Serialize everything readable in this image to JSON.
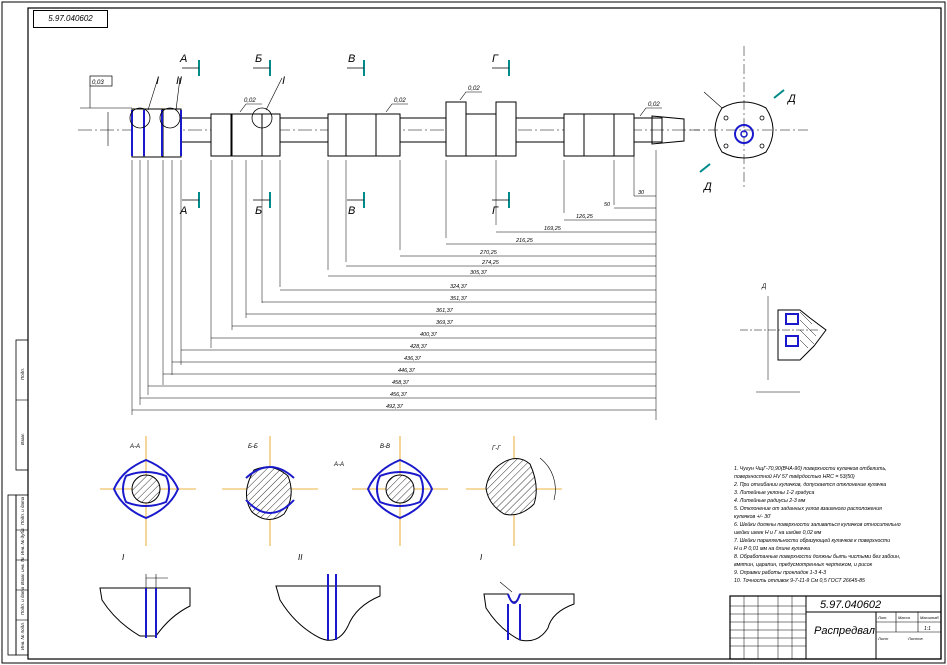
{
  "doc_code_top": "5.97.040602",
  "doc_code": "5.97.040602",
  "title": "Распредвал",
  "section_letters": [
    "А",
    "Б",
    "В",
    "Г"
  ],
  "detail_letters": [
    "I",
    "II"
  ],
  "view_letter": "Д",
  "tolerances": {
    "t1": "0,03",
    "t2": "0,02",
    "t3": "0,02",
    "t4": "0,02",
    "t5": "0,02"
  },
  "dims": [
    "30",
    "50",
    "126,25",
    "169,25",
    "216,25",
    "270,25",
    "274,25",
    "305,37",
    "324,37",
    "351,37",
    "361,37",
    "369,37",
    "400,37",
    "428,37",
    "436,37",
    "446,37",
    "458,37",
    "456,37",
    "492,37"
  ],
  "cam_labels": [
    "A-A",
    "Б-Б",
    "В-В",
    "Г-Г"
  ],
  "notes": [
    "1. Чугун ЧщГ-70,90(ВЧА-90) поверхности кулачков отбелить,",
    "   поверхностной HV 57 твёрдостью HRC = 53(50)",
    "2. При отгибании кулачков, допускается отклонение кулачка",
    "3. Литейные уклоны 1-2 градуса",
    "4. Литейные радиусы 2-3 мм",
    "5. Отклонение от заданных углов взаимного расположения",
    "   кулачков +/- 30'",
    "6. Шейки должны поверхности заливаться кулачков относительно",
    "   шейки шеек  Н и Г на шейке 0,02 мм",
    "7. Шейки параллельности образующей кулачков к поверхности",
    "   Н и Р 0,01 мм на длине кулачка",
    "8. Обработанные поверхности должны быть чистыми без забоин,",
    "   вмятин, царапин, предусмотренных чертежом, и рисок",
    "9. Оправки работы прокладок 1-3 4-3",
    "10. Точность отливок 9-7-11-9 См 0,5 ГОСТ 26645-85"
  ],
  "side_labels": [
    "Подп.",
    "Взам.",
    "Подп. и дата",
    "Инв. № дубл.",
    "Взам. инв. №",
    "Подп. и дата",
    "Инв. № подл."
  ],
  "small_labels": {
    "sheet": "Лист",
    "sheets": "Листов",
    "lit": "Лит.",
    "mass": "Масса",
    "scale": "Масштаб",
    "sheet_num": "1:1"
  }
}
